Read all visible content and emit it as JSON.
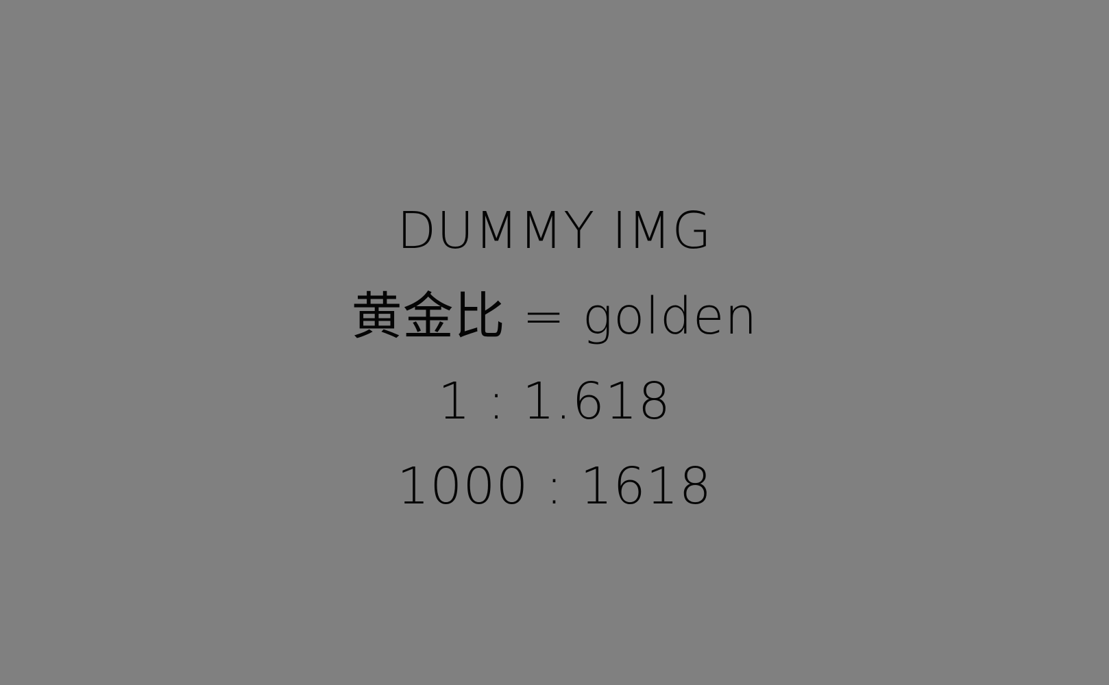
{
  "placeholder": {
    "title": "DUMMY IMG",
    "ratio_label": "黄金比 = golden",
    "ratio_short": "1 : 1.618",
    "ratio_full": "1000 : 1618"
  },
  "colors": {
    "background": "#808080",
    "text": "#050505"
  }
}
